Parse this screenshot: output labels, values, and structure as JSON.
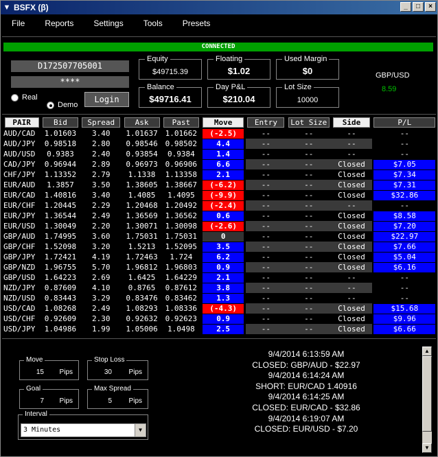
{
  "window": {
    "title": "BSFX (β)"
  },
  "menu": [
    "File",
    "Reports",
    "Settings",
    "Tools",
    "Presets"
  ],
  "status": "CONNECTED",
  "account": {
    "id": "D172507705001",
    "password": "****",
    "real_label": "Real",
    "demo_label": "Demo",
    "selected": "Demo",
    "login_label": "Login"
  },
  "summary": {
    "equity": {
      "label": "Equity",
      "value": "$49715.39"
    },
    "floating": {
      "label": "Floating",
      "value": "$1.02"
    },
    "used_margin": {
      "label": "Used Margin",
      "value": "$0"
    },
    "balance": {
      "label": "Balance",
      "value": "$49716.41"
    },
    "day_pl": {
      "label": "Day P&L",
      "value": "$210.04"
    },
    "lot_size": {
      "label": "Lot Size",
      "value": "10000"
    }
  },
  "selected_pair": {
    "name": "GBP/USD",
    "value": "8.59"
  },
  "columns": [
    "PAIR",
    "Bid",
    "Spread",
    "Ask",
    "Past",
    "Move",
    "Entry",
    "Lot Size",
    "Side",
    "P/L"
  ],
  "rows": [
    [
      "AUD/CAD",
      "1.01603",
      "3.40",
      "1.01637",
      "1.01662",
      "(-2.5)",
      "--",
      "--",
      "--",
      "--"
    ],
    [
      "AUD/JPY",
      "0.98518",
      "2.80",
      "0.98546",
      "0.98502",
      "4.4",
      "--",
      "--",
      "--",
      "--"
    ],
    [
      "AUD/USD",
      "0.9383",
      "2.40",
      "0.93854",
      "0.9384",
      "1.4",
      "--",
      "--",
      "--",
      "--"
    ],
    [
      "CAD/JPY",
      "0.96944",
      "2.89",
      "0.96973",
      "0.96906",
      "6.6",
      "--",
      "--",
      "Closed",
      "$7.05"
    ],
    [
      "CHF/JPY",
      "1.13352",
      "2.79",
      "1.1338",
      "1.13358",
      "2.1",
      "--",
      "--",
      "Closed",
      "$7.34"
    ],
    [
      "EUR/AUD",
      "1.3857",
      "3.50",
      "1.38605",
      "1.38667",
      "(-6.2)",
      "--",
      "--",
      "Closed",
      "$7.31"
    ],
    [
      "EUR/CAD",
      "1.40816",
      "3.40",
      "1.4085",
      "1.4095",
      "(-9.9)",
      "--",
      "--",
      "Closed",
      "$32.86"
    ],
    [
      "EUR/CHF",
      "1.20445",
      "2.29",
      "1.20468",
      "1.20492",
      "(-2.4)",
      "--",
      "--",
      "--",
      "--"
    ],
    [
      "EUR/JPY",
      "1.36544",
      "2.49",
      "1.36569",
      "1.36562",
      "0.6",
      "--",
      "--",
      "Closed",
      "$8.58"
    ],
    [
      "EUR/USD",
      "1.30049",
      "2.20",
      "1.30071",
      "1.30098",
      "(-2.6)",
      "--",
      "--",
      "Closed",
      "$7.20"
    ],
    [
      "GBP/AUD",
      "1.74995",
      "3.60",
      "1.75031",
      "1.75031",
      "0",
      "--",
      "--",
      "Closed",
      "$22.97"
    ],
    [
      "GBP/CHF",
      "1.52098",
      "3.20",
      "1.5213",
      "1.52095",
      "3.5",
      "--",
      "--",
      "Closed",
      "$7.66"
    ],
    [
      "GBP/JPY",
      "1.72421",
      "4.19",
      "1.72463",
      "1.724",
      "6.2",
      "--",
      "--",
      "Closed",
      "$5.04"
    ],
    [
      "GBP/NZD",
      "1.96755",
      "5.70",
      "1.96812",
      "1.96803",
      "0.9",
      "--",
      "--",
      "Closed",
      "$6.16"
    ],
    [
      "GBP/USD",
      "1.64223",
      "2.69",
      "1.6425",
      "1.64229",
      "2.1",
      "--",
      "--",
      "--",
      "--"
    ],
    [
      "NZD/JPY",
      "0.87609",
      "4.10",
      "0.8765",
      "0.87612",
      "3.8",
      "--",
      "--",
      "--",
      "--"
    ],
    [
      "NZD/USD",
      "0.83443",
      "3.29",
      "0.83476",
      "0.83462",
      "1.3",
      "--",
      "--",
      "--",
      "--"
    ],
    [
      "USD/CAD",
      "1.08268",
      "2.49",
      "1.08293",
      "1.08336",
      "(-4.3)",
      "--",
      "--",
      "Closed",
      "$15.68"
    ],
    [
      "USD/CHF",
      "0.92609",
      "2.30",
      "0.92632",
      "0.92623",
      "0.9",
      "--",
      "--",
      "Closed",
      "$9.96"
    ],
    [
      "USD/JPY",
      "1.04986",
      "1.99",
      "1.05006",
      "1.0498",
      "2.5",
      "--",
      "--",
      "Closed",
      "$6.66"
    ]
  ],
  "controls": {
    "move": {
      "label": "Move",
      "value": "15",
      "unit": "Pips"
    },
    "stop_loss": {
      "label": "Stop Loss",
      "value": "30",
      "unit": "Pips"
    },
    "goal": {
      "label": "Goal",
      "value": "7",
      "unit": "Pips"
    },
    "max_spread": {
      "label": "Max Spread",
      "value": "5",
      "unit": "Pips"
    },
    "interval": {
      "label": "Interval",
      "value": "3 Minutes"
    }
  },
  "log": [
    "9/4/2014 6:13:59 AM",
    "CLOSED: GBP/AUD - $22.97",
    "9/4/2014 6:14:24 AM",
    "SHORT: EUR/CAD 1.40916",
    "9/4/2014 6:14:25 AM",
    "CLOSED: EUR/CAD - $32.86",
    "9/4/2014 6:19:07 AM",
    "CLOSED: EUR/USD - $7.20"
  ],
  "colors": {
    "positive": "#0000ff",
    "negative": "#ff0000",
    "connected": "#00a000",
    "pair_value": "#00c000"
  }
}
